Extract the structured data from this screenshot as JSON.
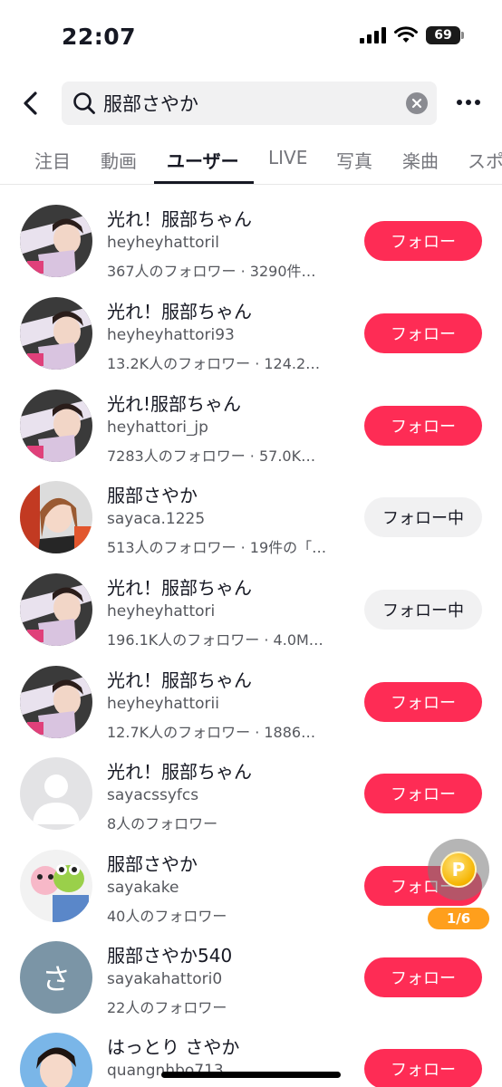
{
  "status_bar": {
    "time": "22:07",
    "battery": "69"
  },
  "search": {
    "query": "服部さやか"
  },
  "tabs": [
    {
      "label": "注目",
      "active": false
    },
    {
      "label": "動画",
      "active": false
    },
    {
      "label": "ユーザー",
      "active": true
    },
    {
      "label": "LIVE",
      "active": false
    },
    {
      "label": "写真",
      "active": false
    },
    {
      "label": "楽曲",
      "active": false
    },
    {
      "label": "スポ",
      "active": false
    }
  ],
  "users": [
    {
      "name": "光れ！服部ちゃん",
      "id": "heyheyhattoril",
      "stats": "367人のフォロワー · 3290件…",
      "button": "フォロー",
      "following": false,
      "avatar": "photo"
    },
    {
      "name": "光れ！服部ちゃん",
      "id": "heyheyhattori93",
      "stats": "13.2K人のフォロワー · 124.2…",
      "button": "フォロー",
      "following": false,
      "avatar": "photo"
    },
    {
      "name": "光れ!服部ちゃん",
      "id": "heyhattori_jp",
      "stats": "7283人のフォロワー · 57.0K…",
      "button": "フォロー",
      "following": false,
      "avatar": "photo"
    },
    {
      "name": "服部さやか",
      "id": "sayaca.1225",
      "stats": "513人のフォロワー · 19件の「…",
      "button": "フォロー中",
      "following": true,
      "avatar": "photo"
    },
    {
      "name": "光れ！服部ちゃん",
      "id": "heyheyhattori",
      "stats": "196.1K人のフォロワー · 4.0M…",
      "button": "フォロー中",
      "following": true,
      "avatar": "photo"
    },
    {
      "name": "光れ！服部ちゃん",
      "id": "heyheyhattorii",
      "stats": "12.7K人のフォロワー · 1886…",
      "button": "フォロー",
      "following": false,
      "avatar": "photo"
    },
    {
      "name": "光れ！服部ちゃん",
      "id": "sayacssyfcs",
      "stats": "8人のフォロワー",
      "button": "フォロー",
      "following": false,
      "avatar": "default"
    },
    {
      "name": "服部さやか",
      "id": "sayakake",
      "stats": "40人のフォロワー",
      "button": "フォロー",
      "following": false,
      "avatar": "photo"
    },
    {
      "name": "服部さやか540",
      "id": "sayakahattori0",
      "stats": "22人のフォロワー",
      "button": "フォロー",
      "following": false,
      "avatar": "letter",
      "avatar_letter": "さ"
    },
    {
      "name": "はっとり さやか",
      "id": "quangnhbo713",
      "stats": "",
      "button": "フォロー",
      "following": false,
      "avatar": "photo"
    }
  ],
  "coin": {
    "counter": "1/6",
    "symbol": "P"
  },
  "colors": {
    "accent": "#fe2c55",
    "following_bg": "#f1f1f2",
    "coin": "#ff9f1c"
  },
  "icons": [
    "back-arrow-icon",
    "search-icon",
    "clear-icon",
    "more-icon",
    "wifi-icon",
    "signal-icon",
    "battery-icon",
    "coin-icon",
    "default-avatar-icon"
  ]
}
